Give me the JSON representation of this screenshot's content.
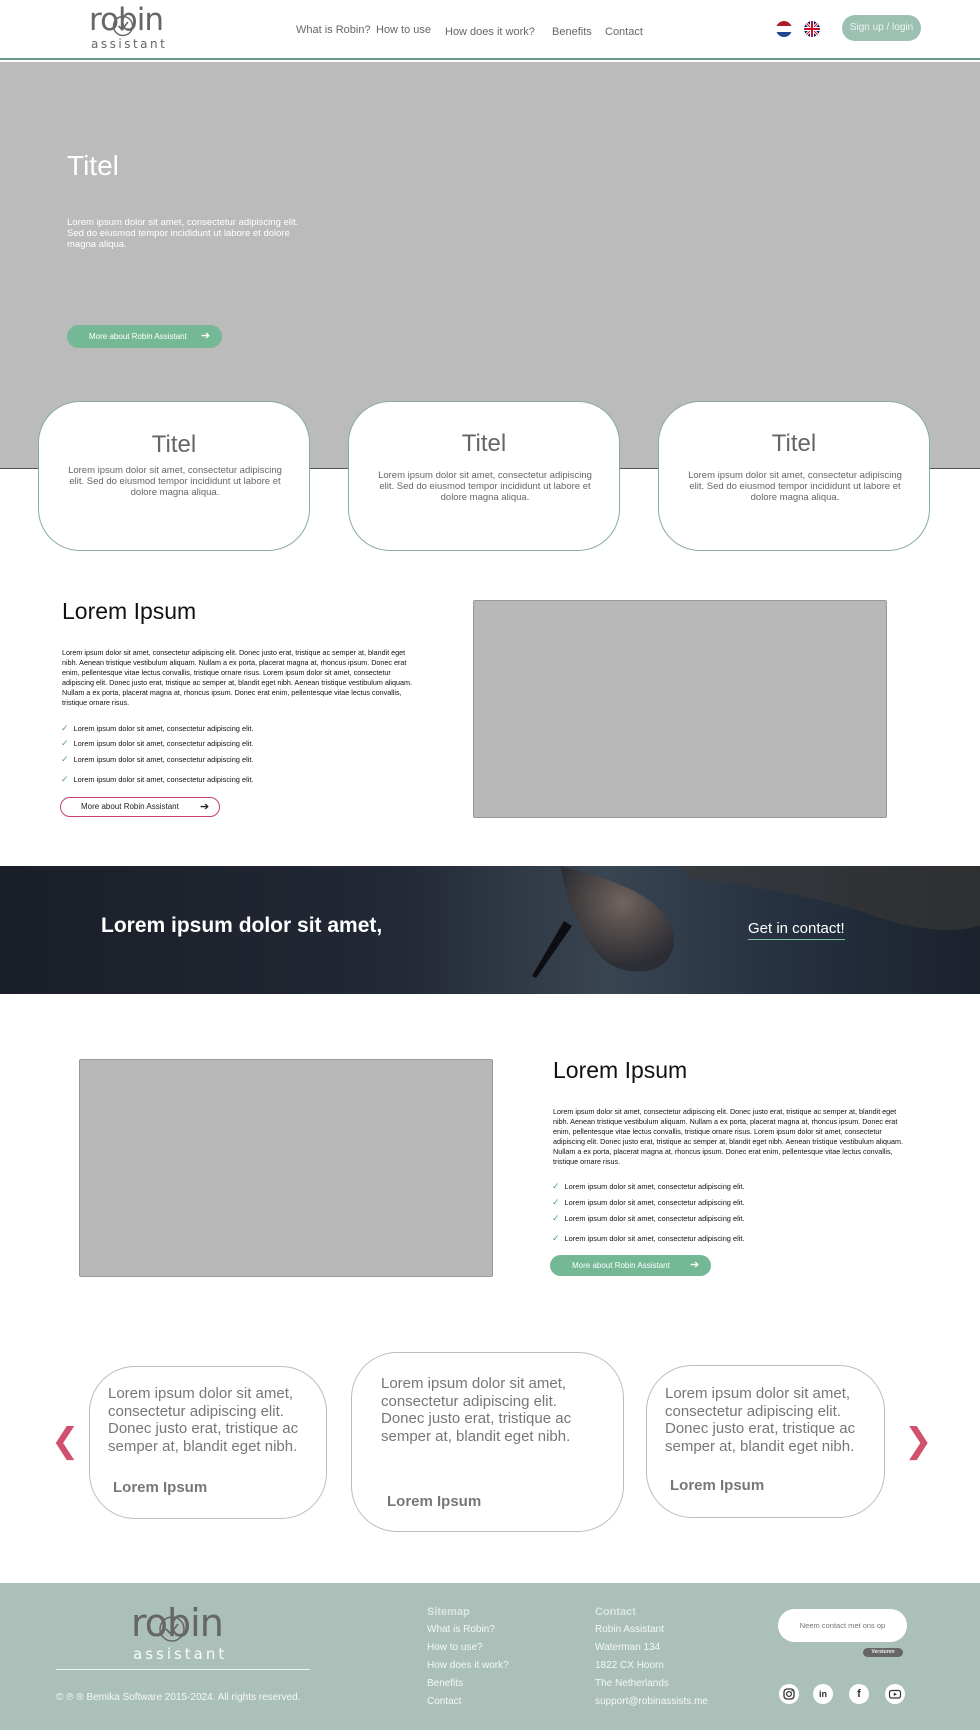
{
  "header": {
    "logo_word": "robin",
    "logo_sub": "assistant",
    "nav": [
      "What is Robin?",
      "How to use",
      "How does it work?",
      "Benefits",
      "Contact"
    ],
    "signup_label": "Sign up / login"
  },
  "hero": {
    "title": "Titel",
    "text": "Lorem ipsum dolor sit amet, consectetur adipiscing elit. Sed do eiusmod tempor incididunt ut labore et dolore magna aliqua.",
    "cta_label": "More about Robin Assistant"
  },
  "feature_cards": [
    {
      "title": "Titel",
      "text": "Lorem ipsum dolor sit amet, consectetur adipiscing elit. Sed do eiusmod tempor incididunt ut labore et dolore magna aliqua."
    },
    {
      "title": "Titel",
      "text": "Lorem ipsum dolor sit amet, consectetur adipiscing elit. Sed do eiusmod tempor incididunt ut labore et dolore magna aliqua."
    },
    {
      "title": "Titel",
      "text": "Lorem ipsum dolor sit amet, consectetur adipiscing elit. Sed do eiusmod tempor incididunt ut labore et dolore magna aliqua."
    }
  ],
  "section1": {
    "title": "Lorem Ipsum",
    "body": "Lorem ipsum dolor sit amet, consectetur adipiscing elit. Donec justo erat, tristique ac semper at, blandit eget nibh. Aenean tristique vestibulum aliquam. Nullam a ex porta, placerat magna at, rhoncus ipsum. Donec erat enim, pellentesque vitae lectus convallis, tristique ornare risus. Lorem ipsum dolor sit amet, consectetur adipiscing elit. Donec justo erat, tristique ac semper at, blandit eget nibh. Aenean tristique vestibulum aliquam. Nullam a ex porta, placerat magna at, rhoncus ipsum. Donec erat enim, pellentesque vitae lectus convallis, tristique ornare risus.",
    "checks": [
      "Lorem ipsum dolor sit amet, consectetur adipiscing elit.",
      "Lorem ipsum dolor sit amet, consectetur adipiscing elit.",
      "Lorem ipsum dolor sit amet, consectetur adipiscing elit.",
      "Lorem ipsum dolor sit amet, consectetur adipiscing elit."
    ],
    "cta_label": "More about Robin Assistant"
  },
  "banner": {
    "title": "Lorem ipsum dolor sit amet,",
    "link_label": "Get in contact!"
  },
  "section2": {
    "title": "Lorem Ipsum",
    "body": "Lorem ipsum dolor sit amet, consectetur adipiscing elit. Donec justo erat, tristique ac semper at, blandit eget nibh. Aenean tristique vestibulum aliquam. Nullam a ex porta, placerat magna at, rhoncus ipsum. Donec erat enim, pellentesque vitae lectus convallis, tristique ornare risus. Lorem ipsum dolor sit amet, consectetur adipiscing elit. Donec justo erat, tristique ac semper at, blandit eget nibh. Aenean tristique vestibulum aliquam. Nullam a ex porta, placerat magna at, rhoncus ipsum. Donec erat enim, pellentesque vitae lectus convallis, tristique ornare risus.",
    "checks": [
      "Lorem ipsum dolor sit amet, consectetur adipiscing elit.",
      "Lorem ipsum dolor sit amet, consectetur adipiscing elit.",
      "Lorem ipsum dolor sit amet, consectetur adipiscing elit.",
      "Lorem ipsum dolor sit amet, consectetur adipiscing elit."
    ],
    "cta_label": "More about Robin Assistant"
  },
  "testimonials": [
    {
      "quote": "Lorem ipsum dolor sit amet, consectetur adipiscing elit. Donec justo erat, tristique ac semper at, blandit eget nibh.",
      "name": "Lorem Ipsum"
    },
    {
      "quote": "Lorem ipsum dolor sit amet, consectetur adipiscing elit. Donec justo erat, tristique ac semper at, blandit eget nibh.",
      "name": "Lorem Ipsum"
    },
    {
      "quote": "Lorem ipsum dolor sit amet, consectetur adipiscing elit. Donec justo erat, tristique ac semper at, blandit eget nibh.",
      "name": "Lorem Ipsum"
    }
  ],
  "footer": {
    "logo_word": "robin",
    "logo_sub": "assistant",
    "copyright": "© ℗ ® Bemika Software 2015-2024. All rights reserved.",
    "sitemap_heading": "Sitemap",
    "sitemap": [
      "What is Robin?",
      "How to use?",
      "How does it work?",
      "Benefits",
      "Contact"
    ],
    "contact_heading": "Contact",
    "contact_lines": [
      "Robin Assistant",
      "Waterman 134",
      "1822 CX Hoorn",
      "The Netherlands",
      "support@robinassists.me"
    ],
    "newsletter_placeholder": "Neem contact met ons op",
    "newsletter_button": "Versturen",
    "socials": [
      "instagram-icon",
      "linkedin-icon",
      "facebook-icon",
      "youtube-icon"
    ]
  },
  "colors": {
    "accent_green": "#74b896",
    "accent_pink": "#c94070",
    "footer_bg": "#abc0b8"
  }
}
